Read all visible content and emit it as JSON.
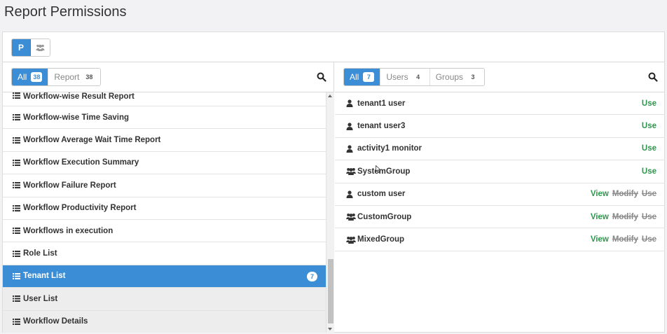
{
  "title": "Report Permissions",
  "top_toggle": {
    "icon_a_label": "P"
  },
  "left": {
    "tabs": [
      {
        "label": "All",
        "count": "38",
        "active": true
      },
      {
        "label": "Report",
        "count": "38",
        "active": false
      }
    ],
    "items": [
      {
        "label": "Workflow-wise Result Report",
        "first": true
      },
      {
        "label": "Workflow-wise Time Saving"
      },
      {
        "label": "Workflow Average Wait Time Report"
      },
      {
        "label": "Workflow Execution Summary"
      },
      {
        "label": "Workflow Failure Report"
      },
      {
        "label": "Workflow Productivity Report"
      },
      {
        "label": "Workflows in execution"
      },
      {
        "label": "Role List"
      },
      {
        "label": "Tenant List",
        "selected": true,
        "count": "7"
      },
      {
        "label": "User List",
        "gray": true
      },
      {
        "label": "Workflow Details",
        "gray": true
      }
    ]
  },
  "right": {
    "tabs": [
      {
        "label": "All",
        "count": "7",
        "active": true
      },
      {
        "label": "Users",
        "count": "4",
        "active": false
      },
      {
        "label": "Groups",
        "count": "3",
        "active": false
      }
    ],
    "items": [
      {
        "name": "tenant1 user",
        "type": "user",
        "perms": [
          {
            "label": "Use",
            "on": true
          }
        ]
      },
      {
        "name": "tenant user3",
        "type": "user",
        "perms": [
          {
            "label": "Use",
            "on": true
          }
        ]
      },
      {
        "name": "activity1 monitor",
        "type": "user",
        "perms": [
          {
            "label": "Use",
            "on": true
          }
        ]
      },
      {
        "name": "SystemGroup",
        "type": "group",
        "perms": [
          {
            "label": "Use",
            "on": true
          }
        ]
      },
      {
        "name": "custom user",
        "type": "user",
        "perms": [
          {
            "label": "View",
            "on": true
          },
          {
            "label": "Modify",
            "on": false
          },
          {
            "label": "Use",
            "on": false
          }
        ]
      },
      {
        "name": "CustomGroup",
        "type": "group",
        "perms": [
          {
            "label": "View",
            "on": true
          },
          {
            "label": "Modify",
            "on": false
          },
          {
            "label": "Use",
            "on": false
          }
        ]
      },
      {
        "name": "MixedGroup",
        "type": "group",
        "perms": [
          {
            "label": "View",
            "on": true
          },
          {
            "label": "Modify",
            "on": false
          },
          {
            "label": "Use",
            "on": false
          }
        ]
      }
    ]
  },
  "colors": {
    "accent": "#3b8ed6",
    "permission_on": "#2a9a4a",
    "permission_off": "#888888"
  }
}
